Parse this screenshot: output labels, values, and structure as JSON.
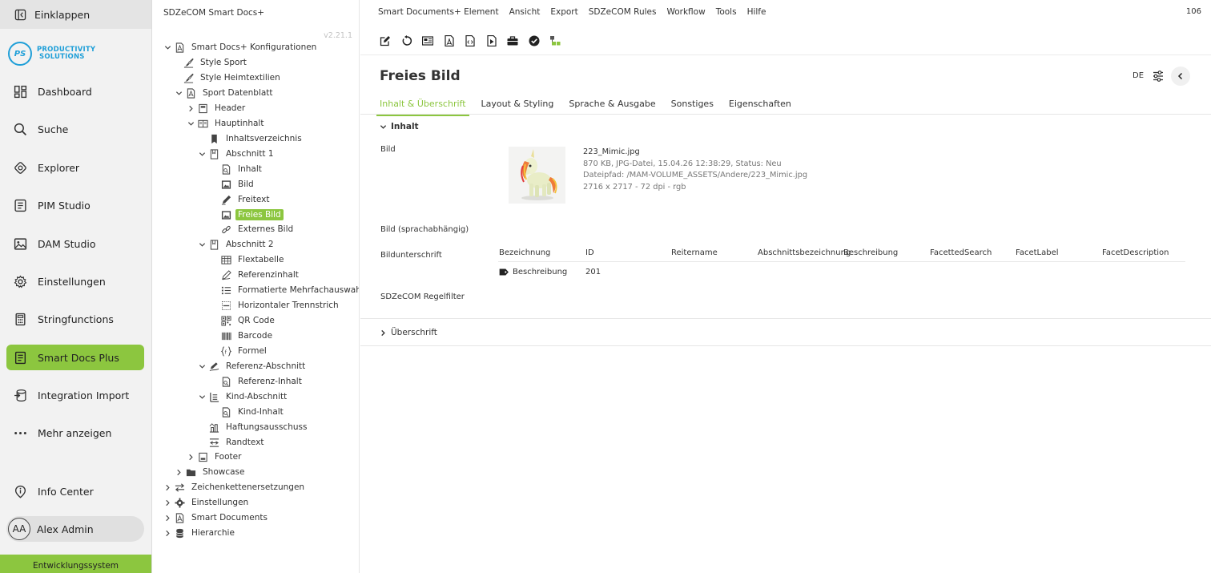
{
  "nav": {
    "collapse_label": "Einklappen",
    "logo_mark": "PS",
    "logo_line1": "PRODUCTIVITY",
    "logo_line2": "SOLUTIONS",
    "items": [
      {
        "label": "Dashboard",
        "icon": "dashboard-icon"
      },
      {
        "label": "Suche",
        "icon": "search-icon"
      },
      {
        "label": "Explorer",
        "icon": "explorer-icon"
      },
      {
        "label": "PIM Studio",
        "icon": "pim-icon"
      },
      {
        "label": "DAM Studio",
        "icon": "image-icon"
      },
      {
        "label": "Einstellungen",
        "icon": "gear-icon"
      },
      {
        "label": "Stringfunctions",
        "icon": "calculator-icon"
      },
      {
        "label": "Smart Docs Plus",
        "icon": "document-icon"
      },
      {
        "label": "Integration Import",
        "icon": "import-icon"
      },
      {
        "label": "Mehr anzeigen",
        "icon": "more-icon"
      },
      {
        "label": "Info Center",
        "icon": "info-icon"
      }
    ],
    "user_initials": "AA",
    "user_name": "Alex Admin",
    "env_label": "Entwicklungssystem",
    "accent": "#8cc63f"
  },
  "tree": {
    "title": "SDZeCOM Smart Docs+",
    "version": "v2.21.1",
    "nodes": [
      "Smart Docs+ Konfigurationen",
      "Style Sport",
      "Style Heimtextilien",
      "Sport Datenblatt",
      "Header",
      "Hauptinhalt",
      "Inhaltsverzeichnis",
      "Abschnitt 1",
      "Inhalt",
      "Bild",
      "Freitext",
      "Freies Bild",
      "Externes Bild",
      "Abschnitt 2",
      "Flextabelle",
      "Referenzinhalt",
      "Formatierte Mehrfachauswahl",
      "Horizontaler Trennstrich",
      "QR Code",
      "Barcode",
      "Formel",
      "Referenz-Abschnitt",
      "Referenz-Inhalt",
      "Kind-Abschnitt",
      "Kind-Inhalt",
      "Haftungsausschuss",
      "Randtext",
      "Footer",
      "Showcase",
      "Zeichenkettenersetzungen",
      "Einstellungen",
      "Smart Documents",
      "Hierarchie"
    ]
  },
  "main": {
    "menu": [
      "Smart Documents+ Element",
      "Ansicht",
      "Export",
      "SDZeCOM Rules",
      "Workflow",
      "Tools",
      "Hilfe"
    ],
    "counter": "106",
    "title": "Freies Bild",
    "lang": "DE",
    "tabs": [
      "Inhalt & Überschrift",
      "Layout & Styling",
      "Sprache & Ausgabe",
      "Sonstiges",
      "Eigenschaften"
    ],
    "section_inhalt": "Inhalt",
    "label_bild": "Bild",
    "image": {
      "filename": "223_Mimic.jpg",
      "meta": "870 KB, JPG-Datei, 15.04.26 12:38:29, Status: Neu",
      "path": "Dateipfad: /MAM-VOLUME_ASSETS/Andere/223_Mimic.jpg",
      "dims": "2716 x 2717 - 72 dpi - rgb"
    },
    "label_bild_sprach": "Bild (sprachabhängig)",
    "label_bildunterschrift": "Bildunterschrift",
    "table": {
      "headers": [
        "Bezeichnung",
        "ID",
        "Reitername",
        "Abschnittsbezeichnung",
        "Beschreibung",
        "FacettedSearch",
        "FacetLabel",
        "FacetDescription"
      ],
      "row": {
        "bezeichnung": "Beschreibung",
        "id": "201"
      }
    },
    "label_regelfilter": "SDZeCOM Regelfilter",
    "section_ueberschrift": "Überschrift"
  }
}
